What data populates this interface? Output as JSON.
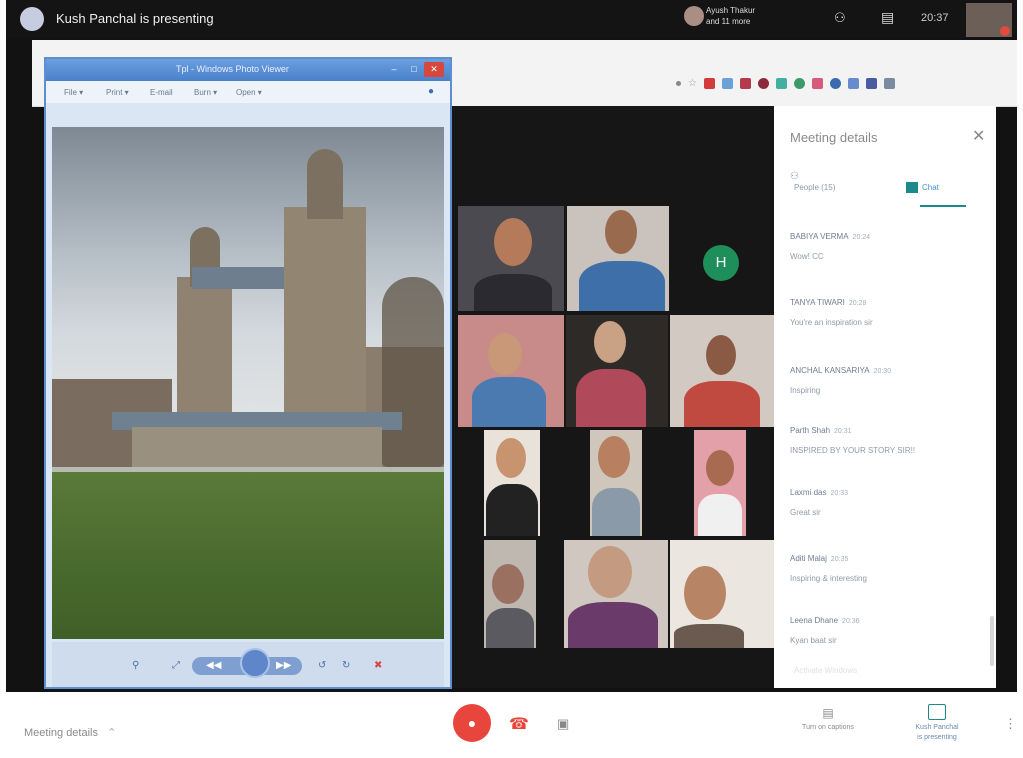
{
  "topbar": {
    "presenter_text": "Kush Panchal is presenting",
    "others_line1": "Ayush Thakur",
    "others_line2": "and 11 more",
    "clock": "20:37"
  },
  "viewer": {
    "title": "Tpl - Windows Photo Viewer",
    "menu": [
      "File ▾",
      "Print ▾",
      "E-mail",
      "Burn ▾",
      "Open ▾"
    ]
  },
  "grid": {
    "h_initial": "H"
  },
  "panel": {
    "title": "Meeting details",
    "tab_people": "People (15)",
    "tab_chat": "Chat",
    "messages": [
      {
        "name": "BABIYA VERMA",
        "time": "20:24",
        "text": "Wow! CC"
      },
      {
        "name": "TANYA TIWARI",
        "time": "20:28",
        "text": "You're an inspiration sir"
      },
      {
        "name": "ANCHAL KANSARIYA",
        "time": "20:30",
        "text": "Inspiring"
      },
      {
        "name": "Parth Shah",
        "time": "20:31",
        "text": "INSPIRED BY YOUR STORY SIR!!"
      },
      {
        "name": "Laxmi das",
        "time": "20:33",
        "text": "Great sir"
      },
      {
        "name": "Aditi Malaj",
        "time": "20:35",
        "text": "Inspiring & interesting"
      },
      {
        "name": "Leena Dhane",
        "time": "20:36",
        "text": "Kyan baat sir"
      }
    ],
    "faded_text": "Activate Windows"
  },
  "bottombar": {
    "meeting_details": "Meeting details",
    "captions": "Turn on captions",
    "presenting_line1": "Kush Panchal",
    "presenting_line2": "is presenting"
  },
  "colors": {
    "accent": "#1c8a8a",
    "mic_off": "#e8453c"
  }
}
